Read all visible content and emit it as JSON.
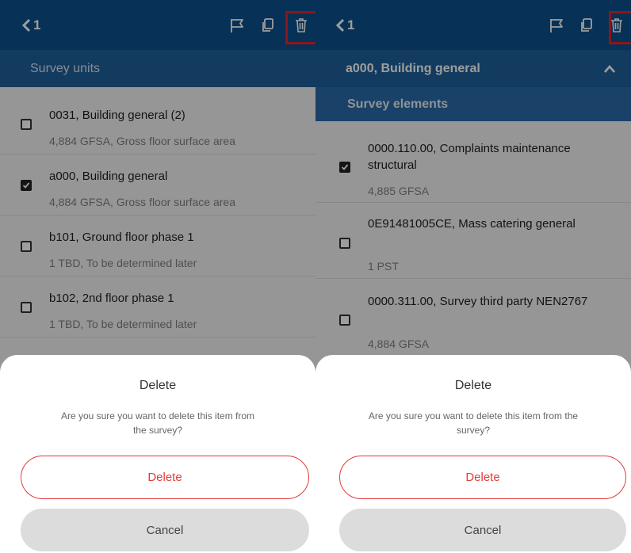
{
  "colors": {
    "header": "#0c4f8c",
    "accent_red": "#e23b3b"
  },
  "left": {
    "back_label": "1",
    "subheader": "Survey units",
    "items": [
      {
        "title": "0031, Building general (2)",
        "sub": "4,884 GFSA, Gross floor surface area",
        "checked": false
      },
      {
        "title": "a000, Building general",
        "sub": "4,884 GFSA, Gross floor surface area",
        "checked": true
      },
      {
        "title": "b101, Ground floor phase 1",
        "sub": "1 TBD, To be determined later",
        "checked": false
      },
      {
        "title": "b102, 2nd floor phase 1",
        "sub": "1 TBD, To be determined later",
        "checked": false
      }
    ],
    "dialog": {
      "title": "Delete",
      "message": "Are you sure you want to delete this item from the survey?",
      "delete_label": "Delete",
      "cancel_label": "Cancel"
    }
  },
  "right": {
    "back_label": "1",
    "subheader": "a000, Building general",
    "section": "Survey elements",
    "items": [
      {
        "title": "0000.110.00, Complaints maintenance structural",
        "sub": "4,885 GFSA",
        "checked": true
      },
      {
        "title": "0E91481005CE, Mass catering general",
        "sub": "1 PST",
        "checked": false
      },
      {
        "title": "0000.311.00, Survey third party NEN2767",
        "sub": "4,884 GFSA",
        "checked": false
      }
    ],
    "dialog": {
      "title": "Delete",
      "message": "Are you sure you want to delete this item from the survey?",
      "delete_label": "Delete",
      "cancel_label": "Cancel"
    }
  },
  "icons": [
    "back-chevron-icon",
    "flag-icon",
    "copy-icon",
    "trash-icon",
    "checkbox-icon",
    "chevron-up-icon"
  ]
}
